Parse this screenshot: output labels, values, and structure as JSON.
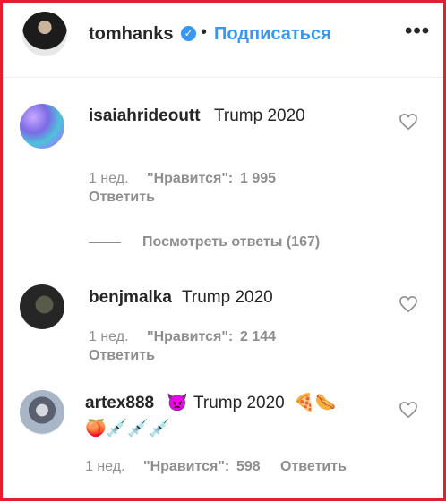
{
  "header": {
    "username": "tomhanks",
    "verified_icon": "verified-check-icon",
    "separator": "•",
    "follow_label": "Подписаться",
    "more_label": "•••"
  },
  "comments": [
    {
      "username": "isaiahrideoutt",
      "text": "Trump 2020",
      "time": "1 нед.",
      "likes_label": "\"Нравится\":",
      "likes": "1 995",
      "reply_label": "Ответить"
    },
    {
      "username": "benjmalka",
      "text": "Trump 2020",
      "time": "1 нед.",
      "likes_label": "\"Нравится\":",
      "likes": "2 144",
      "reply_label": "Ответить"
    },
    {
      "username": "artex888",
      "text": "Trump 2020",
      "emojis_before": "👿",
      "emojis_after": "🍕🌭",
      "emojis_line2": "🍑💉💉💉",
      "time": "1 нед.",
      "likes_label": "\"Нравится\":",
      "likes": "598",
      "reply_label": "Ответить"
    }
  ],
  "view_replies": "Посмотреть ответы (167)",
  "colors": {
    "accent": "#3897f0",
    "frame": "#e0202e",
    "muted": "#8e8e8e",
    "text": "#262626"
  }
}
